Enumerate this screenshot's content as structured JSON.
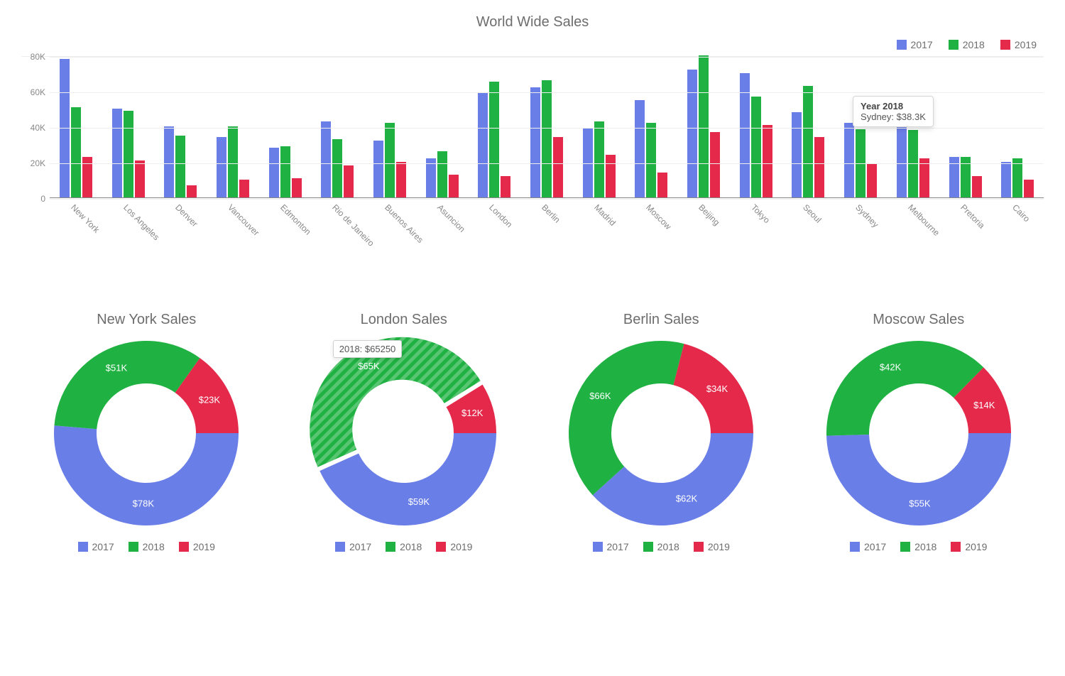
{
  "title": "World Wide Sales",
  "colors": {
    "y2017": "#6a7ee8",
    "y2018": "#1fb141",
    "y2019": "#e4294a"
  },
  "legend_labels": {
    "y2017": "2017",
    "y2018": "2018",
    "y2019": "2019"
  },
  "chart_data": [
    {
      "type": "bar",
      "title": "World Wide Sales",
      "xlabel": "",
      "ylabel": "",
      "ylim": [
        0,
        80000
      ],
      "y_ticks": [
        "0",
        "20K",
        "40K",
        "60K",
        "80K"
      ],
      "categories": [
        "New York",
        "Los Angeles",
        "Denver",
        "Vancouver",
        "Edmonton",
        "Rio de Janeiro",
        "Buenos Aires",
        "Asuncion",
        "London",
        "Berlin",
        "Madrid",
        "Moscow",
        "Beijing",
        "Tokyo",
        "Seoul",
        "Sydney",
        "Melbourne",
        "Pretoria",
        "Cairo"
      ],
      "series": [
        {
          "name": "2017",
          "values": [
            78000,
            50000,
            40000,
            34000,
            28000,
            43000,
            32000,
            22000,
            59000,
            62000,
            39000,
            55000,
            72000,
            70000,
            48000,
            42000,
            45000,
            23000,
            20000
          ]
        },
        {
          "name": "2018",
          "values": [
            51000,
            49000,
            35000,
            40000,
            29000,
            33000,
            42000,
            26000,
            65250,
            66000,
            43000,
            42000,
            80000,
            57000,
            63000,
            38300,
            38000,
            23000,
            22000
          ]
        },
        {
          "name": "2019",
          "values": [
            23000,
            21000,
            7000,
            10000,
            11000,
            18000,
            20000,
            13000,
            12000,
            34000,
            24000,
            14000,
            37000,
            41000,
            34000,
            19000,
            22000,
            12000,
            10000
          ]
        }
      ]
    },
    {
      "type": "pie",
      "title": "New York Sales",
      "series": [
        {
          "name": "2017",
          "value": 78000,
          "label": "$78K"
        },
        {
          "name": "2018",
          "value": 51000,
          "label": "$51K"
        },
        {
          "name": "2019",
          "value": 23000,
          "label": "$23K"
        }
      ]
    },
    {
      "type": "pie",
      "title": "London Sales",
      "series": [
        {
          "name": "2017",
          "value": 59000,
          "label": "$59K"
        },
        {
          "name": "2018",
          "value": 65250,
          "label": "$65K",
          "hover": true,
          "hover_text": "2018: $65250"
        },
        {
          "name": "2019",
          "value": 12000,
          "label": "$12K"
        }
      ]
    },
    {
      "type": "pie",
      "title": "Berlin Sales",
      "series": [
        {
          "name": "2017",
          "value": 62000,
          "label": "$62K"
        },
        {
          "name": "2018",
          "value": 66000,
          "label": "$66K"
        },
        {
          "name": "2019",
          "value": 34000,
          "label": "$34K"
        }
      ]
    },
    {
      "type": "pie",
      "title": "Moscow Sales",
      "series": [
        {
          "name": "2017",
          "value": 55000,
          "label": "$55K"
        },
        {
          "name": "2018",
          "value": 42000,
          "label": "$42K"
        },
        {
          "name": "2019",
          "value": 14000,
          "label": "$14K"
        }
      ]
    }
  ],
  "bar_tooltip": {
    "title_prefix": "Year ",
    "year": "2018",
    "city": "Sydney",
    "value_text": "$38.3K"
  }
}
